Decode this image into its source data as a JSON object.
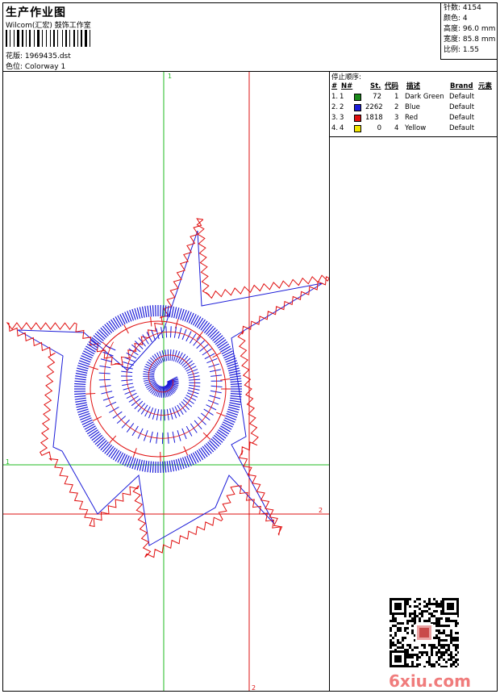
{
  "header": {
    "title": "生产作业图",
    "company": "Wilcom(汇宏) 鼓饰工作室",
    "design_label": "花版: 1969435.dst",
    "colorway_label": "色位: Colorway 1"
  },
  "stats": [
    {
      "label": "针数:",
      "value": "4154"
    },
    {
      "label": "颜色:",
      "value": "4"
    },
    {
      "label": "高度:",
      "value": "96.0 mm"
    },
    {
      "label": "宽度:",
      "value": "85.8 mm"
    },
    {
      "label": "比例:",
      "value": "1.55"
    }
  ],
  "stop_sequence": {
    "title": "停止顺序:",
    "columns": [
      "#",
      "N#",
      "St.",
      "代码",
      "描述",
      "Brand",
      "元素"
    ],
    "rows": [
      {
        "idx": "1.",
        "n": "1",
        "st": "72",
        "code": "1",
        "desc": "Dark Green",
        "brand": "Default",
        "color": "#1a8a1a"
      },
      {
        "idx": "2.",
        "n": "2",
        "st": "2262",
        "code": "2",
        "desc": "Blue",
        "brand": "Default",
        "color": "#1c1cd8"
      },
      {
        "idx": "3.",
        "n": "3",
        "st": "1818",
        "code": "3",
        "desc": "Red",
        "brand": "Default",
        "color": "#e01010"
      },
      {
        "idx": "4.",
        "n": "4",
        "st": "0",
        "code": "4",
        "desc": "Yellow",
        "brand": "Default",
        "color": "#f2e600"
      }
    ]
  },
  "guides": {
    "green_label": "1",
    "red_label": "2"
  },
  "watermark": "6xiu.com"
}
